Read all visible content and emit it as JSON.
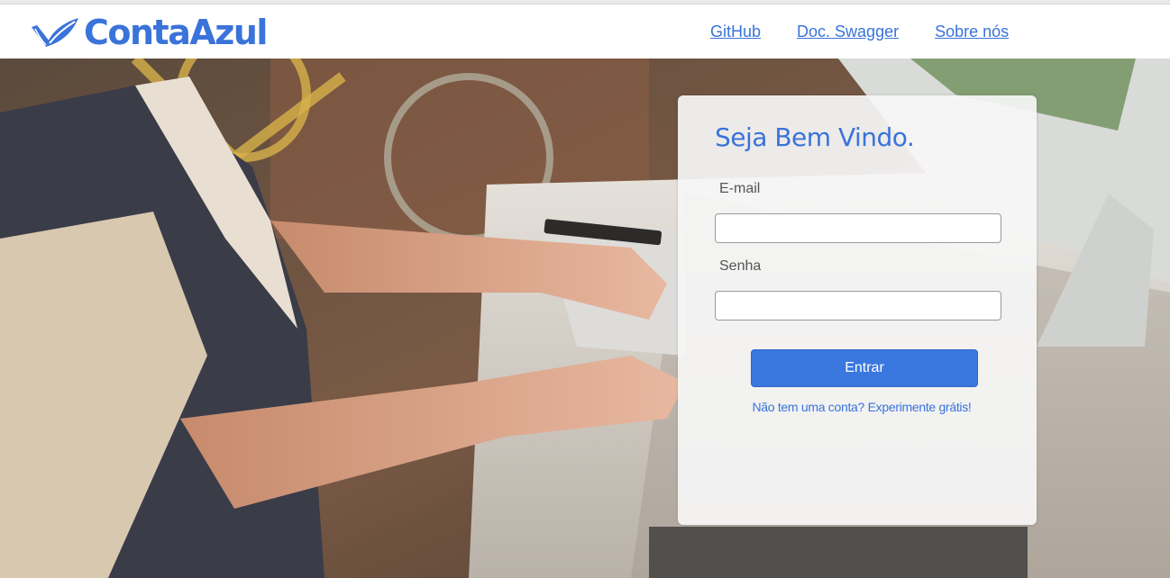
{
  "brand": {
    "name": "ContaAzul",
    "logo_icon": "leaf-check-icon",
    "color": "#3a73d9"
  },
  "nav": {
    "links": [
      {
        "label": "GitHub"
      },
      {
        "label": "Doc. Swagger"
      },
      {
        "label": "Sobre nós"
      }
    ]
  },
  "login": {
    "title": "Seja Bem Vindo.",
    "email_label": "E-mail",
    "email_value": "",
    "password_label": "Senha",
    "password_value": "",
    "submit_label": "Entrar",
    "signup_link": "Não tem uma conta? Experimente grátis!",
    "accent_color": "#3a78e0"
  }
}
